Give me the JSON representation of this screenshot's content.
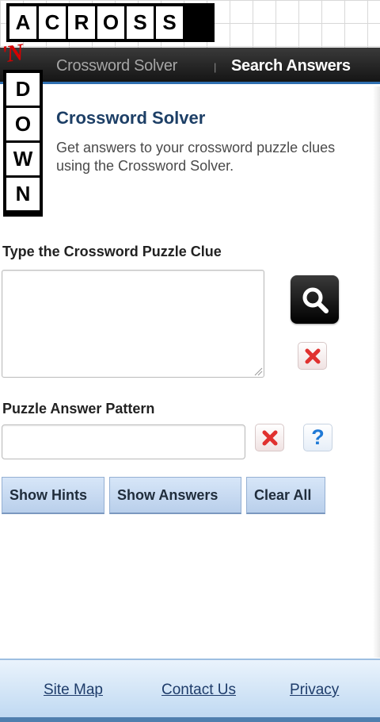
{
  "logo": {
    "across": [
      "A",
      "C",
      "R",
      "O",
      "S",
      "S"
    ],
    "connector": "'N",
    "down": [
      "D",
      "O",
      "W",
      "N"
    ]
  },
  "nav": {
    "solver": "Crossword Solver",
    "separator": "|",
    "search": "Search Answers"
  },
  "intro": {
    "title": "Crossword Solver",
    "description": "Get answers to your crossword puzzle clues using the Crossword Solver."
  },
  "clue": {
    "label": "Type the Crossword Puzzle Clue",
    "value": "",
    "placeholder": ""
  },
  "pattern": {
    "label": "Puzzle Answer Pattern",
    "value": "",
    "placeholder": ""
  },
  "icons": {
    "search": "search-icon",
    "clear": "close-icon",
    "help": "question-icon"
  },
  "help_symbol": "?",
  "buttons": {
    "hints": "Show Hints",
    "answers": "Show Answers",
    "clear_all": "Clear All"
  },
  "footer": {
    "sitemap": "Site Map",
    "contact": "Contact Us",
    "privacy": "Privacy"
  },
  "colors": {
    "nav_bg": "#1f1f1f",
    "title": "#1d3f66",
    "button_bg": "#c9dbf1",
    "clear_x": "#e0312f",
    "help": "#1f79d6",
    "footer_bg": "#d3e5f6"
  }
}
